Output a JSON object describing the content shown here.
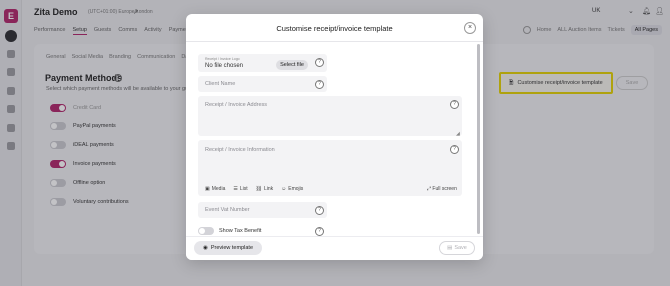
{
  "app": {
    "logo_letter": "E",
    "title": "Zita Demo",
    "subtitle": "(UTC+01:00) Europe/London",
    "language": "UK",
    "nav_tabs": [
      "Performance",
      "Setup",
      "Guests",
      "Comms",
      "Activity",
      "Payments"
    ],
    "active_tab": "Setup",
    "right_tabs": [
      "Home",
      "ALL Auction Items",
      "Tickets"
    ],
    "all_pages_label": "All Pages",
    "sub_tabs": [
      "General",
      "Social Media",
      "Branding",
      "Communication",
      "Data R"
    ],
    "payment_methods": {
      "title": "Payment Methods",
      "description": "Select which payment methods will be available to your gu",
      "items": [
        {
          "label": "Credit Card",
          "on": true,
          "dim": true
        },
        {
          "label": "PayPal payments",
          "on": false,
          "dim": false
        },
        {
          "label": "iDEAL payments",
          "on": false,
          "dim": false
        },
        {
          "label": "Invoice payments",
          "on": true,
          "dim": false
        },
        {
          "label": "Offline option",
          "on": false,
          "dim": false
        },
        {
          "label": "Voluntary contributions",
          "on": false,
          "dim": false
        }
      ]
    },
    "customise_button": "Customise receipt/invoice template",
    "save_label": "Save"
  },
  "modal": {
    "title": "Customise receipt/invoice template",
    "close_symbol": "×",
    "upload": {
      "label": "Receipt / Invoice Logo",
      "value": "No file chosen",
      "button": "Select file"
    },
    "client_name_placeholder": "Client Name",
    "address_placeholder": "Receipt / Invoice Address",
    "information_placeholder": "Receipt / Invoice Information",
    "toolbar": {
      "media": "Media",
      "list": "List",
      "link": "Link",
      "emojis": "Emojis",
      "full_screen": "Full screen"
    },
    "vat_placeholder": "Event Vat Number",
    "show_tax_benefit": {
      "label": "Show Tax Benefit",
      "on": false
    },
    "preview_button": "Preview template",
    "save_button": "Save",
    "help_symbol": "?"
  },
  "colors": {
    "accent": "#b0246a",
    "highlight": "#e3d200"
  }
}
